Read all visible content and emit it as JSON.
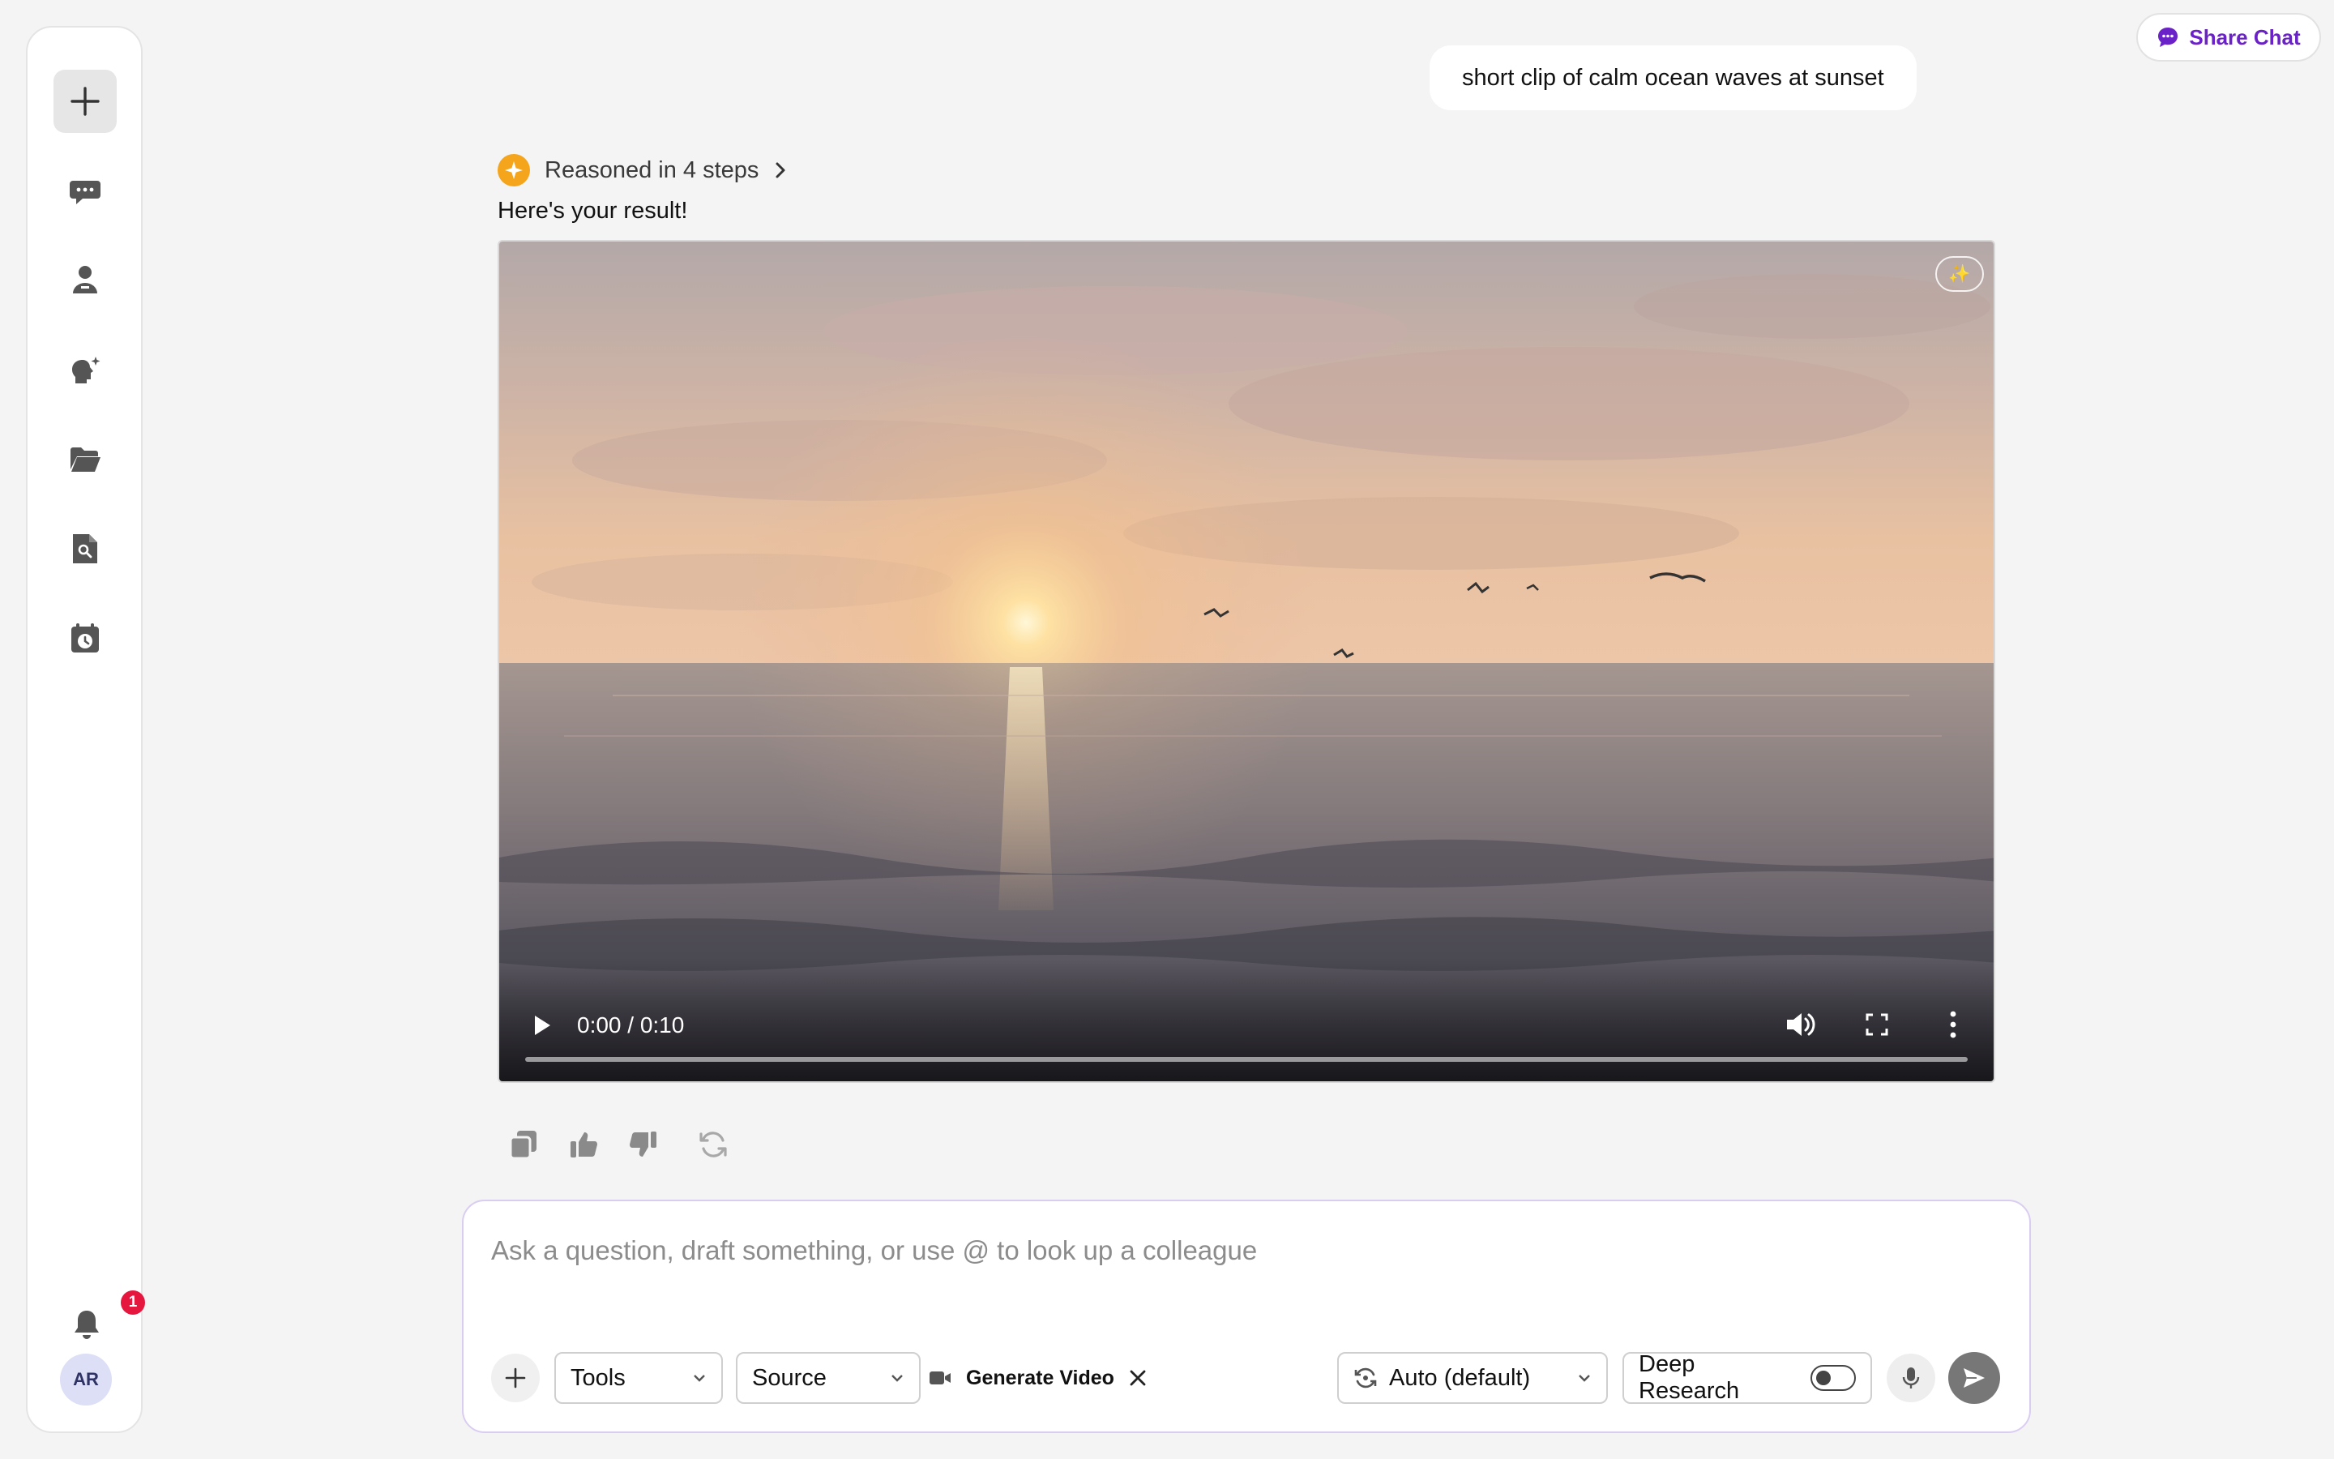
{
  "sidebar": {
    "items": [
      {
        "icon": "plus-icon",
        "name": "new-chat-button"
      },
      {
        "icon": "chat-bubbles-icon",
        "name": "sidebar-item-chats"
      },
      {
        "icon": "person-icon",
        "name": "sidebar-item-people"
      },
      {
        "icon": "sparkle-head-icon",
        "name": "sidebar-item-agents"
      },
      {
        "icon": "folder-open-icon",
        "name": "sidebar-item-files"
      },
      {
        "icon": "document-search-icon",
        "name": "sidebar-item-documents"
      },
      {
        "icon": "calendar-clock-icon",
        "name": "sidebar-item-schedule"
      }
    ],
    "notification_count": "1",
    "avatar_initials": "AR"
  },
  "header": {
    "share_label": "Share Chat",
    "accent_color": "#6b21c8"
  },
  "conversation": {
    "user_message": "short clip of calm ocean waves at sunset",
    "reasoning_label": "Reasoned in 4 steps",
    "result_text": "Here's your result!",
    "video": {
      "time_display": "0:00 / 0:10",
      "badge_icon": "sparkles-icon",
      "progress_fraction": 0
    },
    "actions": [
      "copy-icon",
      "thumbs-up-icon",
      "thumbs-down-icon",
      "regenerate-icon"
    ]
  },
  "composer": {
    "placeholder": "Ask a question, draft something, or use @ to look up a colleague",
    "tools_label": "Tools",
    "source_label": "Source",
    "generate_label": "Generate Video",
    "model_label": "Auto (default)",
    "deep_research_label": "Deep Research",
    "deep_research_enabled": false
  }
}
